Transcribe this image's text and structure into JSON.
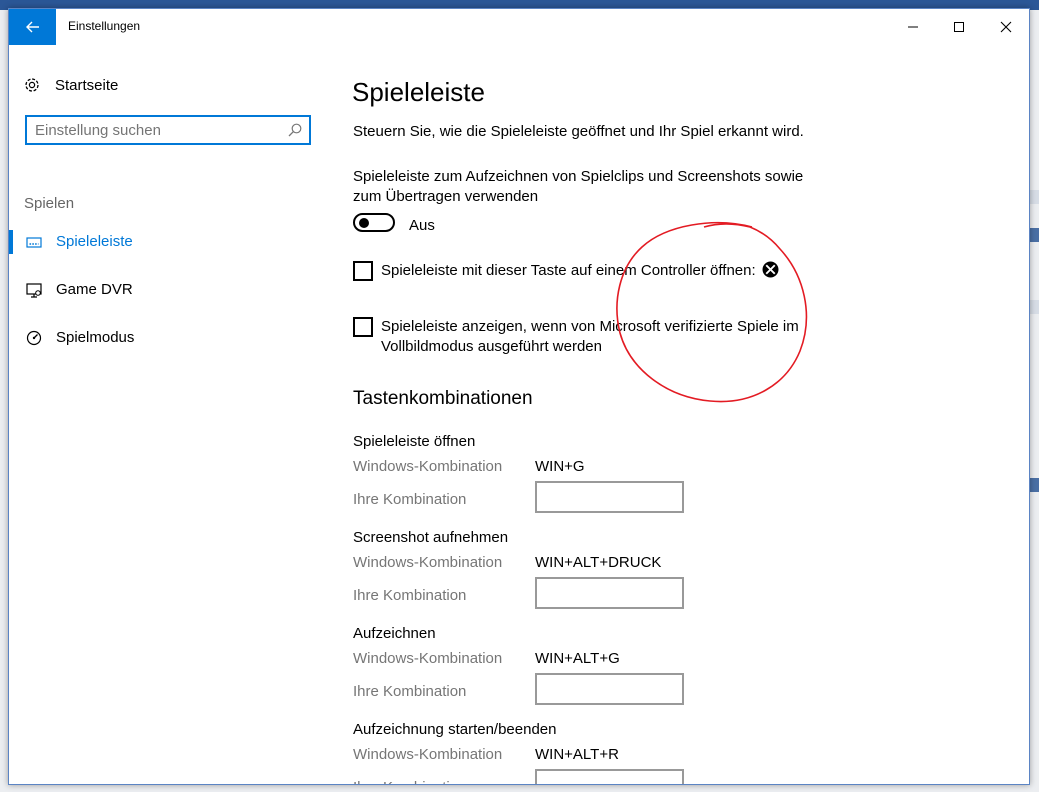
{
  "window": {
    "title": "Einstellungen",
    "back_icon": "arrow-left-icon",
    "minimize_icon": "minimize-icon",
    "maximize_icon": "maximize-icon",
    "close_icon": "close-icon"
  },
  "sidebar": {
    "home": {
      "label": "Startseite",
      "icon": "gear-icon"
    },
    "search": {
      "placeholder": "Einstellung suchen",
      "icon": "search-icon"
    },
    "section": "Spielen",
    "items": [
      {
        "label": "Spieleleiste",
        "icon": "game-bar-icon",
        "active": true
      },
      {
        "label": "Game DVR",
        "icon": "game-dvr-icon",
        "active": false
      },
      {
        "label": "Spielmodus",
        "icon": "game-mode-icon",
        "active": false
      }
    ]
  },
  "content": {
    "title": "Spieleleiste",
    "description": "Steuern Sie, wie die Spieleleiste geöffnet und Ihr Spiel erkannt wird.",
    "toggle_setting": {
      "label": "Spieleleiste zum Aufzeichnen von Spielclips und Screenshots sowie zum Übertragen verwenden",
      "state_label": "Aus",
      "on": false
    },
    "checkboxes": [
      {
        "label": "Spieleleiste mit dieser Taste auf einem Controller öffnen:",
        "checked": false,
        "icon": "xbox-icon"
      },
      {
        "label": "Spieleleiste anzeigen, wenn von Microsoft verifizierte Spiele im Vollbildmodus ausgeführt werden",
        "checked": false
      }
    ],
    "shortcuts_title": "Tastenkombinationen",
    "windows_combo_label": "Windows-Kombination",
    "your_combo_label": "Ihre Kombination",
    "shortcuts": [
      {
        "name": "Spieleleiste öffnen",
        "windows_combo": "WIN+G",
        "your_combo": ""
      },
      {
        "name": "Screenshot aufnehmen",
        "windows_combo": "WIN+ALT+DRUCK",
        "your_combo": ""
      },
      {
        "name": "Aufzeichnen",
        "windows_combo": "WIN+ALT+G",
        "your_combo": ""
      },
      {
        "name": "Aufzeichnung starten/beenden",
        "windows_combo": "WIN+ALT+R",
        "your_combo": ""
      }
    ]
  },
  "colors": {
    "accent": "#0078d7",
    "annotation_circle": "#e31b23",
    "secondary_text": "#767676"
  }
}
